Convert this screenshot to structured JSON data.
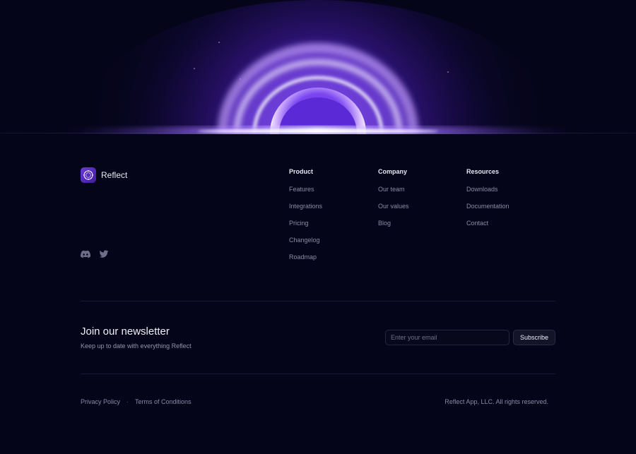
{
  "brand": {
    "name": "Reflect",
    "icon": "reflect-logo-icon"
  },
  "social": [
    {
      "icon": "discord-icon"
    },
    {
      "icon": "twitter-icon"
    }
  ],
  "columns": [
    {
      "title": "Product",
      "links": [
        "Features",
        "Integrations",
        "Pricing",
        "Changelog",
        "Roadmap"
      ]
    },
    {
      "title": "Company",
      "links": [
        "Our team",
        "Our values",
        "Blog"
      ]
    },
    {
      "title": "Resources",
      "links": [
        "Downloads",
        "Documentation",
        "Contact"
      ]
    }
  ],
  "newsletter": {
    "title": "Join our newsletter",
    "subtitle": "Keep up to date with everything Reflect",
    "email_placeholder": "Enter your email",
    "email_value": "",
    "subscribe_label": "Subscribe"
  },
  "legal": {
    "privacy": "Privacy Policy",
    "separator": "·",
    "terms": "Terms of Conditions",
    "copyright": "Reflect App, LLC. All rights reserved."
  },
  "colors": {
    "background": "#05051a",
    "accent": "#7c4dff",
    "glow": "#c9a8ff"
  }
}
